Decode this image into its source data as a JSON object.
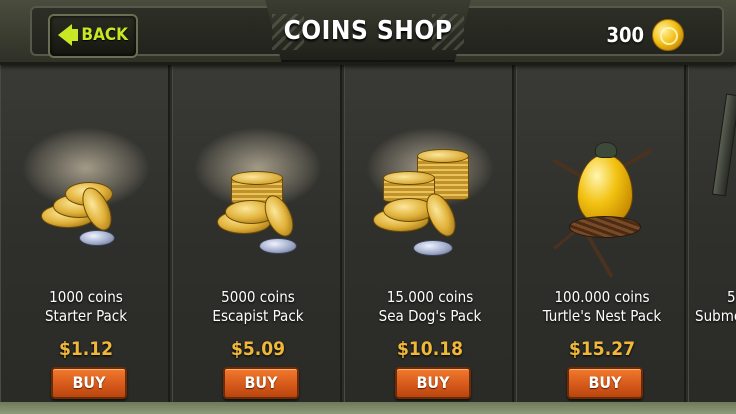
{
  "header": {
    "title": "COINS SHOP",
    "back_label": "BACK",
    "coin_balance": "300"
  },
  "packs": [
    {
      "amount": "1000 coins",
      "name": "Starter Pack",
      "price": "$1.12",
      "buy_label": "BUY",
      "art": "coin-pile-small"
    },
    {
      "amount": "5000 coins",
      "name": "Escapist Pack",
      "price": "$5.09",
      "buy_label": "BUY",
      "art": "coin-pile-medium"
    },
    {
      "amount": "15.000 coins",
      "name": "Sea Dog's Pack",
      "price": "$10.18",
      "buy_label": "BUY",
      "art": "coin-pile-large"
    },
    {
      "amount": "100.000 coins",
      "name": "Turtle's Nest Pack",
      "price": "$15.27",
      "buy_label": "BUY",
      "art": "golden-egg-nest"
    },
    {
      "amount": "5",
      "name": "Submer",
      "art": "partial-card"
    }
  ],
  "colors": {
    "accent_lime": "#c8e826",
    "price_gold": "#f0b83a",
    "buy_orange": "#d4571a"
  }
}
